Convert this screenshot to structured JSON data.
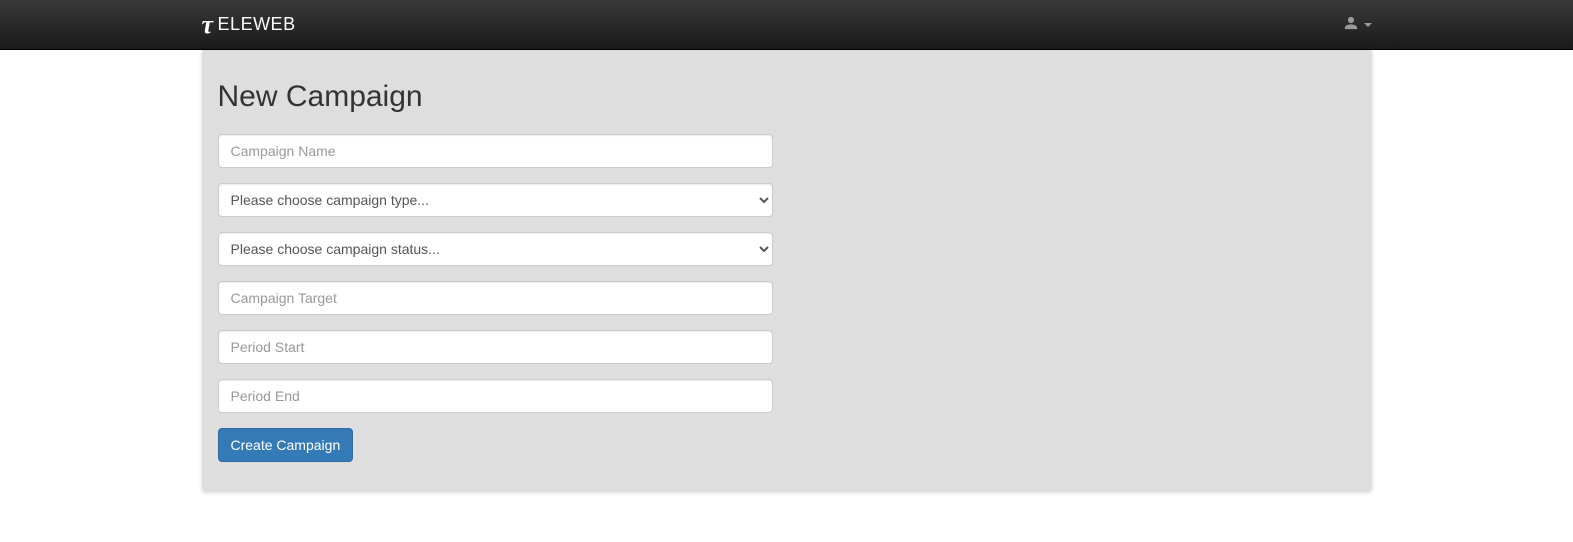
{
  "navbar": {
    "brand_text": "ELEWEB"
  },
  "page": {
    "title": "New Campaign"
  },
  "form": {
    "campaign_name": {
      "placeholder": "Campaign Name",
      "value": ""
    },
    "campaign_type": {
      "placeholder_option": "Please choose campaign type...",
      "value": ""
    },
    "campaign_status": {
      "placeholder_option": "Please choose campaign status...",
      "value": ""
    },
    "campaign_target": {
      "placeholder": "Campaign Target",
      "value": ""
    },
    "period_start": {
      "placeholder": "Period Start",
      "value": ""
    },
    "period_end": {
      "placeholder": "Period End",
      "value": ""
    },
    "submit_label": "Create Campaign"
  }
}
